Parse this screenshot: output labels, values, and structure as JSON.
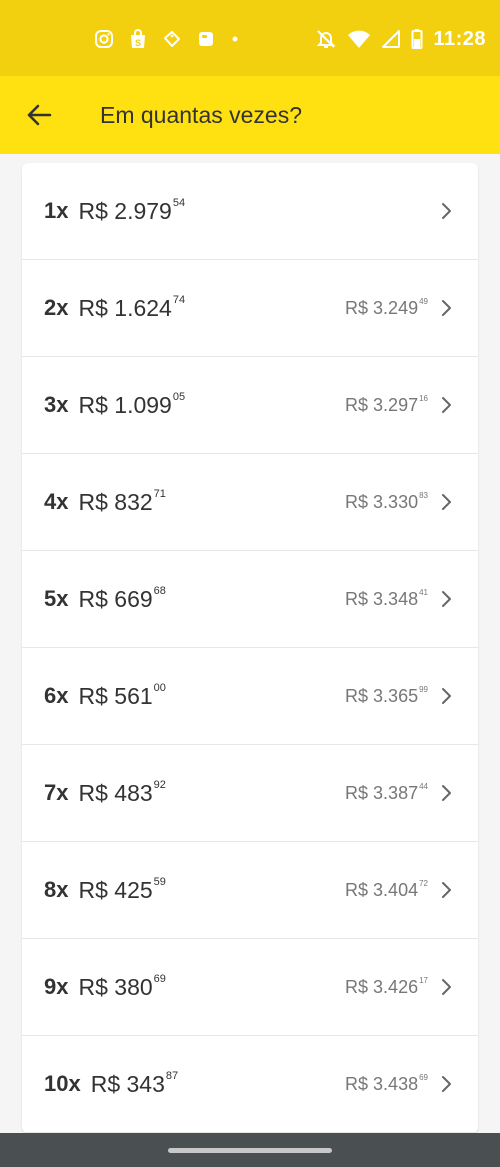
{
  "status_bar": {
    "time": "11:28",
    "left_icons": [
      "instagram-icon",
      "shopping-bag-icon",
      "tag-icon",
      "b-app-icon",
      "dot-icon"
    ],
    "right_icons": [
      "mute-icon",
      "wifi-icon",
      "signal-icon",
      "battery-icon"
    ]
  },
  "app_bar": {
    "title": "Em quantas vezes?",
    "back_icon": "arrow-left-icon"
  },
  "installments": [
    {
      "count": "1x",
      "price": "R$ 2.979",
      "cents": "54",
      "total": "",
      "total_cents": ""
    },
    {
      "count": "2x",
      "price": "R$ 1.624",
      "cents": "74",
      "total": "R$ 3.249",
      "total_cents": "49"
    },
    {
      "count": "3x",
      "price": "R$ 1.099",
      "cents": "05",
      "total": "R$ 3.297",
      "total_cents": "16"
    },
    {
      "count": "4x",
      "price": "R$ 832",
      "cents": "71",
      "total": "R$ 3.330",
      "total_cents": "83"
    },
    {
      "count": "5x",
      "price": "R$ 669",
      "cents": "68",
      "total": "R$ 3.348",
      "total_cents": "41"
    },
    {
      "count": "6x",
      "price": "R$ 561",
      "cents": "00",
      "total": "R$ 3.365",
      "total_cents": "99"
    },
    {
      "count": "7x",
      "price": "R$ 483",
      "cents": "92",
      "total": "R$ 3.387",
      "total_cents": "44"
    },
    {
      "count": "8x",
      "price": "R$ 425",
      "cents": "59",
      "total": "R$ 3.404",
      "total_cents": "72"
    },
    {
      "count": "9x",
      "price": "R$ 380",
      "cents": "69",
      "total": "R$ 3.426",
      "total_cents": "17"
    },
    {
      "count": "10x",
      "price": "R$ 343",
      "cents": "87",
      "total": "R$ 3.438",
      "total_cents": "69"
    }
  ],
  "colors": {
    "status_bar": "#f2d010",
    "app_bar": "#ffe112",
    "nav_bar": "#4a4f52"
  }
}
